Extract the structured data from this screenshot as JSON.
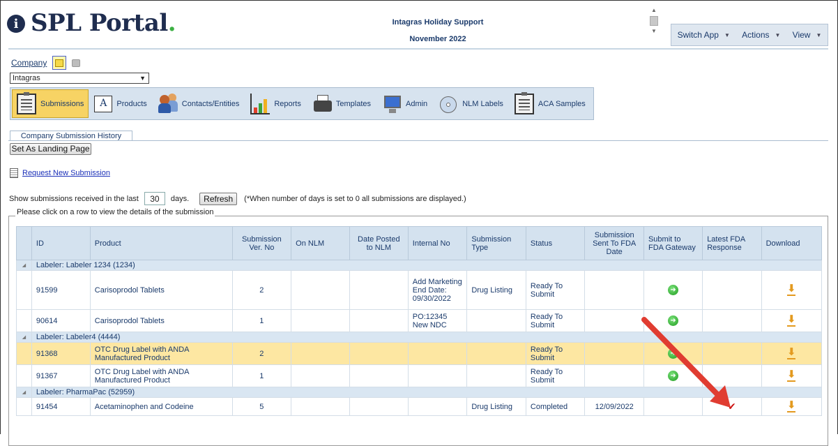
{
  "app": {
    "logo_text": "SPL Portal",
    "logo_dot": ".",
    "logo_badge": "i",
    "header_line1": "Intagras Holiday Support",
    "header_line2": "November 2022"
  },
  "topmenu": {
    "items": [
      "Switch App",
      "Actions",
      "View"
    ]
  },
  "company": {
    "label": "Company",
    "selected": "Intagras"
  },
  "modules": [
    "Submissions",
    "Products",
    "Contacts/Entities",
    "Reports",
    "Templates",
    "Admin",
    "NLM Labels",
    "ACA Samples"
  ],
  "tab": {
    "label": "Company Submission History"
  },
  "landing_button": "Set As Landing Page",
  "request_link": "Request New Submission",
  "filter": {
    "prefix": "Show submissions received in the last",
    "days": "30",
    "suffix": "days.",
    "refresh": "Refresh",
    "note": "(*When number of days is set to 0 all submissions are displayed.)"
  },
  "legend": "Please click on a row to view the details of the submission",
  "table": {
    "headers": [
      "ID",
      "Product",
      "Submission Ver. No",
      "On NLM",
      "Date Posted to NLM",
      "Internal No",
      "Submission Type",
      "Status",
      "Submission Sent To FDA Date",
      "Submit to FDA Gateway",
      "Latest FDA Response",
      "Download"
    ],
    "groups": [
      {
        "label": "Labeler: Labeler 1234 (1234)"
      },
      {
        "label": "Labeler: Labeler4 (4444)"
      },
      {
        "label": "Labeler: PharmaPac (52959)"
      }
    ],
    "rows": [
      {
        "id": "91599",
        "product": "Carisoprodol Tablets",
        "ver": "2",
        "internal": "Add Marketing End Date: 09/30/2022",
        "type": "Drug Listing",
        "status": "Ready To Submit",
        "sent": ""
      },
      {
        "id": "90614",
        "product": "Carisoprodol Tablets",
        "ver": "1",
        "internal": "PO:12345 New NDC",
        "type": "",
        "status": "Ready To Submit",
        "sent": ""
      },
      {
        "id": "91368",
        "product": "OTC Drug Label with ANDA Manufactured Product",
        "ver": "2",
        "internal": "",
        "type": "",
        "status": "Ready To Submit",
        "sent": ""
      },
      {
        "id": "91367",
        "product": "OTC Drug Label with ANDA Manufactured Product",
        "ver": "1",
        "internal": "",
        "type": "",
        "status": "Ready To Submit",
        "sent": ""
      },
      {
        "id": "91454",
        "product": "Acetaminophen and Codeine",
        "ver": "5",
        "internal": "",
        "type": "Drug Listing",
        "status": "Completed",
        "sent": "12/09/2022"
      }
    ]
  },
  "colors": {
    "brand_navy": "#1f2d4f",
    "brand_green": "#3cb043",
    "header_bg": "#d4e2ef",
    "highlight_row": "#fde7a2",
    "annotation_arrow": "#e03c31"
  }
}
